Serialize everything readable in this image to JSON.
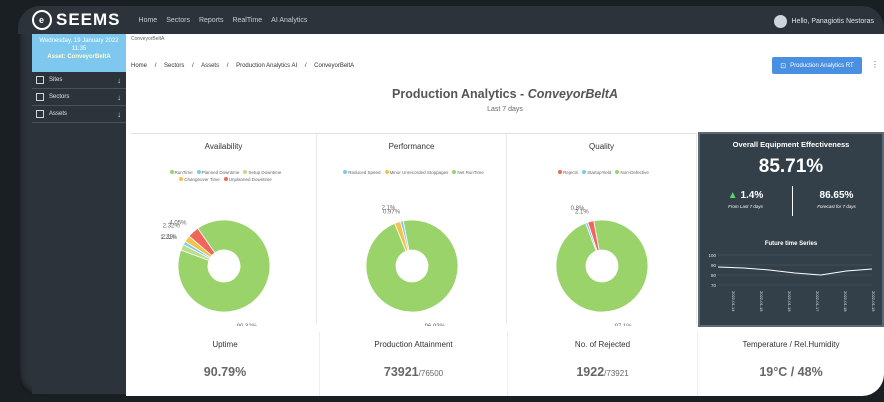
{
  "app": {
    "logo": "SEEMS",
    "nav": [
      "Home",
      "Sectors",
      "Reports",
      "RealTime",
      "AI Analytics"
    ],
    "user": "Hello, Panagiotis Nestoras"
  },
  "sidebar": {
    "date": "Wednesday, 19 January 2022",
    "time": "11:35",
    "asset_label": "Asset: ConveyorBeltA",
    "items": [
      {
        "label": "Sites",
        "icon": "building-icon"
      },
      {
        "label": "Sectors",
        "icon": "layers-icon"
      },
      {
        "label": "Assets",
        "icon": "hierarchy-icon"
      }
    ]
  },
  "breadcrumb_top": "ConveyorBeltA",
  "breadcrumb": [
    "Home",
    "/",
    "Sectors",
    "/",
    "Assets",
    "/",
    "Production Analytics AI",
    "/",
    "ConveyorBeltA"
  ],
  "button_rt": "Production Analytics RT",
  "title_prefix": "Production Analytics - ",
  "title_asset": "ConveyorBeltA",
  "subtitle": "Last 7 days",
  "colors": {
    "green": "#9ad36a",
    "red": "#f0665b",
    "orange": "#f4c24a",
    "blue": "#7ec8ef",
    "yellow": "#f4e34a",
    "lightgreen": "#b8e08a",
    "oee_bg": "#344049"
  },
  "panels": [
    {
      "title": "Availability",
      "legend": [
        [
          "RunTime",
          "#9ad36a"
        ],
        [
          "Planned Downtime",
          "#7ec8ef"
        ],
        [
          "Setup Downtime",
          "#b8e08a"
        ],
        [
          "Changeover Time",
          "#f4c24a"
        ],
        [
          "Unplanned Downtime",
          "#f0665b"
        ]
      ],
      "slices": [
        90.32,
        2.1,
        1.21,
        2.32,
        4.05
      ],
      "slice_colors": [
        "#9ad36a",
        "#b8e08a",
        "#7ec8ef",
        "#f4c24a",
        "#f0665b"
      ],
      "labels": [
        "90.32%",
        "2.1%",
        "1.21%",
        "2.32%",
        "4.05%"
      ]
    },
    {
      "title": "Performance",
      "legend": [
        [
          "Reduced Speed",
          "#7ec8ef"
        ],
        [
          "Minor Unrecorded Stoppages",
          "#f4c24a"
        ],
        [
          "Net RunTime",
          "#9ad36a"
        ]
      ],
      "slices": [
        96.93,
        2.1,
        0.97
      ],
      "slice_colors": [
        "#9ad36a",
        "#f4c24a",
        "#7ec8ef"
      ],
      "labels": [
        "96.93%",
        "2.1%",
        "0.97%"
      ]
    },
    {
      "title": "Quality",
      "legend": [
        [
          "Rejects",
          "#f0665b"
        ],
        [
          "StartupYield",
          "#7ec8ef"
        ],
        [
          "Non-Defective",
          "#9ad36a"
        ]
      ],
      "slices": [
        97.1,
        0.8,
        2.1
      ],
      "slice_colors": [
        "#9ad36a",
        "#7ec8ef",
        "#f0665b"
      ],
      "labels": [
        "97.1%",
        "0.8%",
        "2.1%"
      ]
    }
  ],
  "oee": {
    "title": "Overall Equipment Effectiveness",
    "value": "85.71%",
    "change": "1.4%",
    "change_label": "From Last 7 days",
    "forecast": "86.65%",
    "forecast_label": "Forecast for 7 days",
    "series_title": "Future time Series",
    "y_ticks": [
      "100",
      "90",
      "80",
      "70"
    ],
    "x_ticks": [
      "2022-01-14",
      "2022-01-15",
      "2022-01-16",
      "2022-01-17",
      "2022-01-18",
      "2022-01-19"
    ],
    "series_values": [
      88,
      87,
      85,
      82,
      80,
      84,
      86
    ]
  },
  "bottom": [
    {
      "label": "Uptime",
      "value": "90.79%",
      "small": ""
    },
    {
      "label": "Production Attainment",
      "value": "73921",
      "small": "/76500"
    },
    {
      "label": "No. of Rejected",
      "value": "1922",
      "small": "/73921"
    },
    {
      "label": "Temperature / Rel.Humidity",
      "value": "19°C / 48%",
      "small": ""
    }
  ]
}
